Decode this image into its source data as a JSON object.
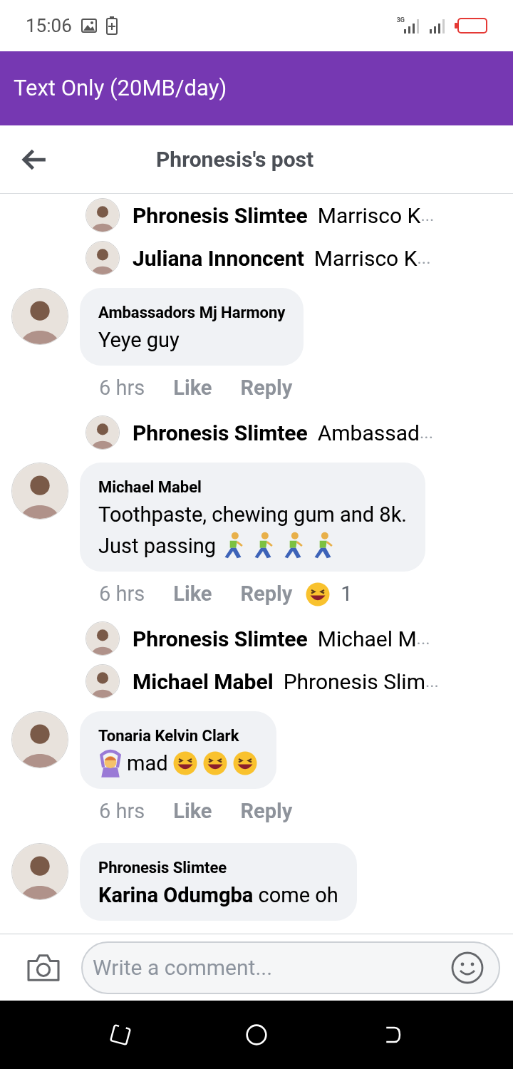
{
  "status_bar": {
    "time": "15:06",
    "network": "3G"
  },
  "app_banner": {
    "title": "Text Only (20MB/day)"
  },
  "nav": {
    "title": "Phronesis's post"
  },
  "thread": [
    {
      "kind": "reply_preview",
      "name": "Phronesis Slimtee",
      "text": "Marrisco K",
      "ellipsis": "..."
    },
    {
      "kind": "reply_preview",
      "name": "Juliana Innoncent",
      "text": "Marrisco K",
      "ellipsis": "..."
    },
    {
      "kind": "comment",
      "name": "Ambassadors Mj Harmony",
      "lines": [
        [
          {
            "kind": "text",
            "text": "Yeye guy"
          }
        ]
      ],
      "time": "6 hrs",
      "like": "Like",
      "reply": "Reply"
    },
    {
      "kind": "reply_preview",
      "name": "Phronesis Slimtee",
      "text": "Ambassad",
      "ellipsis": "..."
    },
    {
      "kind": "comment",
      "name": "Michael Mabel",
      "lines": [
        [
          {
            "kind": "text",
            "text": "Toothpaste, chewing gum and 8k."
          }
        ],
        [
          {
            "kind": "text",
            "text": "Just passing"
          },
          {
            "kind": "runner"
          },
          {
            "kind": "runner"
          },
          {
            "kind": "runner"
          },
          {
            "kind": "runner"
          }
        ]
      ],
      "time": "6 hrs",
      "like": "Like",
      "reply": "Reply",
      "reaction_count": "1"
    },
    {
      "kind": "reply_preview",
      "name": "Phronesis Slimtee",
      "text": "Michael M",
      "ellipsis": "..."
    },
    {
      "kind": "reply_preview",
      "name": "Michael Mabel",
      "text": "Phronesis Slim",
      "ellipsis": "..."
    },
    {
      "kind": "comment",
      "name": "Tonaria Kelvin Clark",
      "lines": [
        [
          {
            "kind": "ok_gesture"
          },
          {
            "kind": "text",
            "text": "mad"
          },
          {
            "kind": "rofl"
          },
          {
            "kind": "rofl"
          },
          {
            "kind": "rofl"
          }
        ]
      ],
      "time": "6 hrs",
      "like": "Like",
      "reply": "Reply"
    },
    {
      "kind": "comment",
      "name": "Phronesis Slimtee",
      "lines": [
        [
          {
            "kind": "text",
            "text": "**Karina Odumgba** come oh"
          }
        ]
      ]
    }
  ],
  "composer": {
    "placeholder": "Write a comment..."
  }
}
